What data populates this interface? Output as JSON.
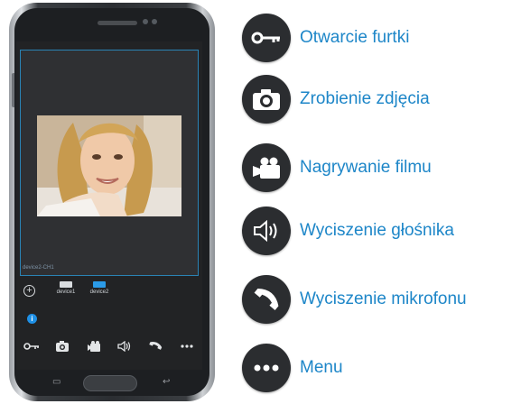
{
  "phone": {
    "channel_label": "device2-CH1",
    "devices": [
      {
        "label": "device1",
        "color": "#d9dcdf"
      },
      {
        "label": "device2",
        "color": "#2b9be8"
      }
    ],
    "add_symbol": "+",
    "info_symbol": "i",
    "toolbar": [
      {
        "icon": "key-icon"
      },
      {
        "icon": "camera-icon"
      },
      {
        "icon": "video-camera-icon"
      },
      {
        "icon": "speaker-icon"
      },
      {
        "icon": "phone-handset-icon"
      },
      {
        "icon": "more-icon"
      }
    ]
  },
  "legend": [
    {
      "icon": "key-icon",
      "label": "Otwarcie furtki"
    },
    {
      "icon": "camera-icon",
      "label": "Zrobienie zdjęcia"
    },
    {
      "icon": "video-camera-icon",
      "label": "Nagrywanie filmu"
    },
    {
      "icon": "speaker-icon",
      "label": "Wyciszenie głośnika"
    },
    {
      "icon": "phone-handset-icon",
      "label": "Wyciszenie mikrofonu"
    },
    {
      "icon": "more-icon",
      "label": "Menu"
    }
  ],
  "colors": {
    "accent": "#1d86c8",
    "icon_circle": "#2b2d30",
    "selection_frame": "#2a83b5"
  }
}
